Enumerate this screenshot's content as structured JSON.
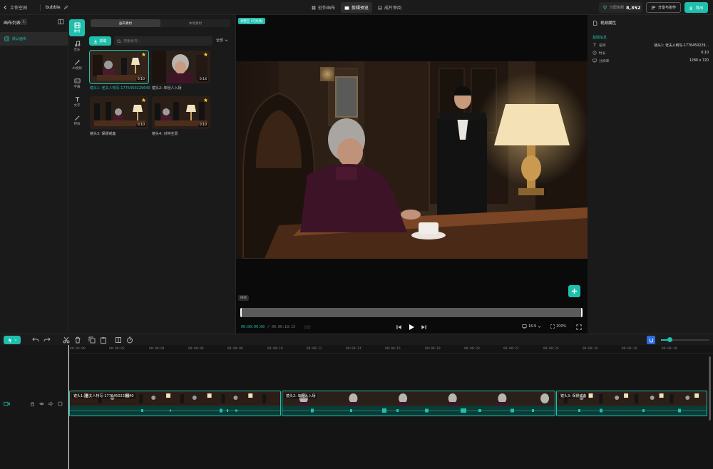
{
  "topbar": {
    "back_label": "工作空间",
    "project_name": "bubble",
    "modes": [
      {
        "label": "创作画布",
        "active": false
      },
      {
        "label": "剪辑预览",
        "active": true
      },
      {
        "label": "成片审阅",
        "active": false
      }
    ],
    "credits_label": "分配余额",
    "credits_value": "8,352",
    "share_label": "分享与协作",
    "export_label": "导出"
  },
  "canvas_list": {
    "title": "画布列表",
    "count": "1",
    "items": [
      {
        "label": "默认画布"
      }
    ]
  },
  "rail": [
    {
      "label": "素材",
      "icon": "film-icon",
      "active": true
    },
    {
      "label": "音乐",
      "icon": "music-note-icon",
      "active": false
    },
    {
      "label": "AI视频",
      "icon": "magic-wand-icon",
      "active": false
    },
    {
      "label": "字幕",
      "icon": "subtitle-icon",
      "active": false
    },
    {
      "label": "文字",
      "icon": "text-icon",
      "active": false
    },
    {
      "label": "特效",
      "icon": "sparkle-icon",
      "active": false
    }
  ],
  "assets": {
    "tabs": [
      {
        "label": "画布素材",
        "active": true
      },
      {
        "label": "本地素材",
        "active": false
      }
    ],
    "get_label": "获取",
    "search_placeholder": "搜索素材...",
    "filter_label": "全部",
    "items": [
      {
        "caption": "镜头1: 老夫人特写-1776450229640",
        "duration": "0:10",
        "starred": true,
        "selected": true
      },
      {
        "caption": "镜头2: 年轻人入场",
        "duration": "0:14",
        "starred": true,
        "selected": false
      },
      {
        "caption": "镜头3: 保镖戒备",
        "duration": "0:10",
        "starred": true,
        "selected": false
      },
      {
        "caption": "镜头4: 对峙全景",
        "duration": "0:10",
        "starred": true,
        "selected": false
      }
    ]
  },
  "preview": {
    "tag": "调整区 (可拖拽)",
    "note": "拼帧",
    "current_time": "00:00:00:00",
    "total_time": "/ 00:00:10:15",
    "ratio": "16:9",
    "zoom": "100%"
  },
  "properties": {
    "title": "视频属性",
    "section": "基础信息",
    "rows": [
      {
        "icon": "text-icon",
        "key": "名称",
        "value": "镜头1: 老夫人特写-1776450229..."
      },
      {
        "icon": "clock-icon",
        "key": "时长",
        "value": "0:10"
      },
      {
        "icon": "monitor-icon",
        "key": "分辨率",
        "value": "1280 x 720"
      }
    ]
  },
  "timeline": {
    "ticks": [
      "00:00:00",
      "00:00:02",
      "00:00:04",
      "00:00:06",
      "00:00:08",
      "00:00:10",
      "00:00:12",
      "00:00:14",
      "00:00:16",
      "00:00:18",
      "00:00:20",
      "00:00:22",
      "00:00:24",
      "00:00:26",
      "00:00:28",
      "00:00:30"
    ],
    "clips": [
      {
        "label": "镜头1: 老夫人特写-1776450229640"
      },
      {
        "label": "镜头2: 年轻人入场"
      },
      {
        "label": "镜头3: 保镖戒备"
      }
    ]
  },
  "colors": {
    "accent": "#1fbfae",
    "background": "#141414",
    "panel": "#1a1a1a",
    "snap": "#2a6ae0"
  }
}
